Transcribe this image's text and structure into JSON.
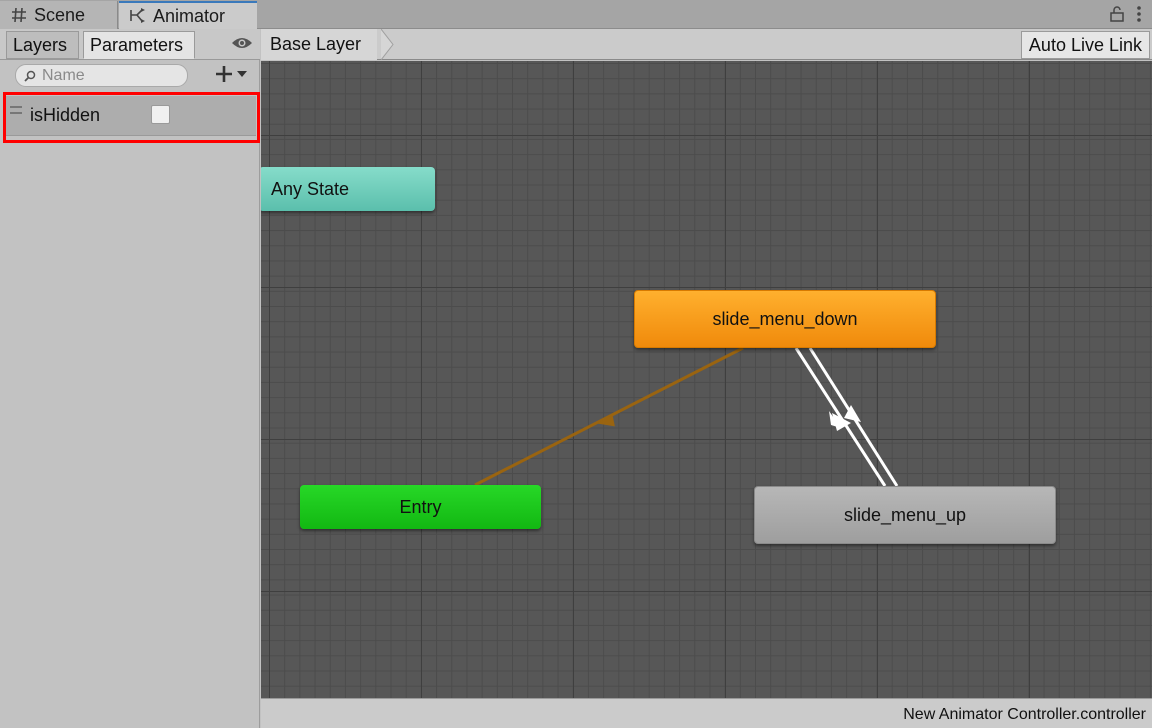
{
  "tabs": {
    "scene": "Scene",
    "animator": "Animator"
  },
  "left_panel": {
    "tab_layers": "Layers",
    "tab_parameters": "Parameters",
    "search_placeholder": "Name",
    "parameters": [
      {
        "name": "isHidden",
        "type": "bool",
        "value": false
      }
    ]
  },
  "graph": {
    "breadcrumb": "Base Layer",
    "auto_live_link": "Auto Live Link",
    "states": {
      "any_state": "Any State",
      "slide_menu_down": "slide_menu_down",
      "entry": "Entry",
      "slide_menu_up": "slide_menu_up"
    },
    "transitions": [
      {
        "from": "Entry",
        "to": "slide_menu_down",
        "type": "default"
      },
      {
        "from": "slide_menu_down",
        "to": "slide_menu_up"
      },
      {
        "from": "slide_menu_up",
        "to": "slide_menu_down"
      }
    ]
  },
  "status": {
    "file": "New Animator Controller.controller"
  },
  "colors": {
    "highlight": "#ff0000",
    "state_default": "#f08a0b",
    "state_entry": "#12b812",
    "state_any": "#5bbfac",
    "state_normal": "#9e9e9e",
    "default_transition": "#9a6410"
  }
}
